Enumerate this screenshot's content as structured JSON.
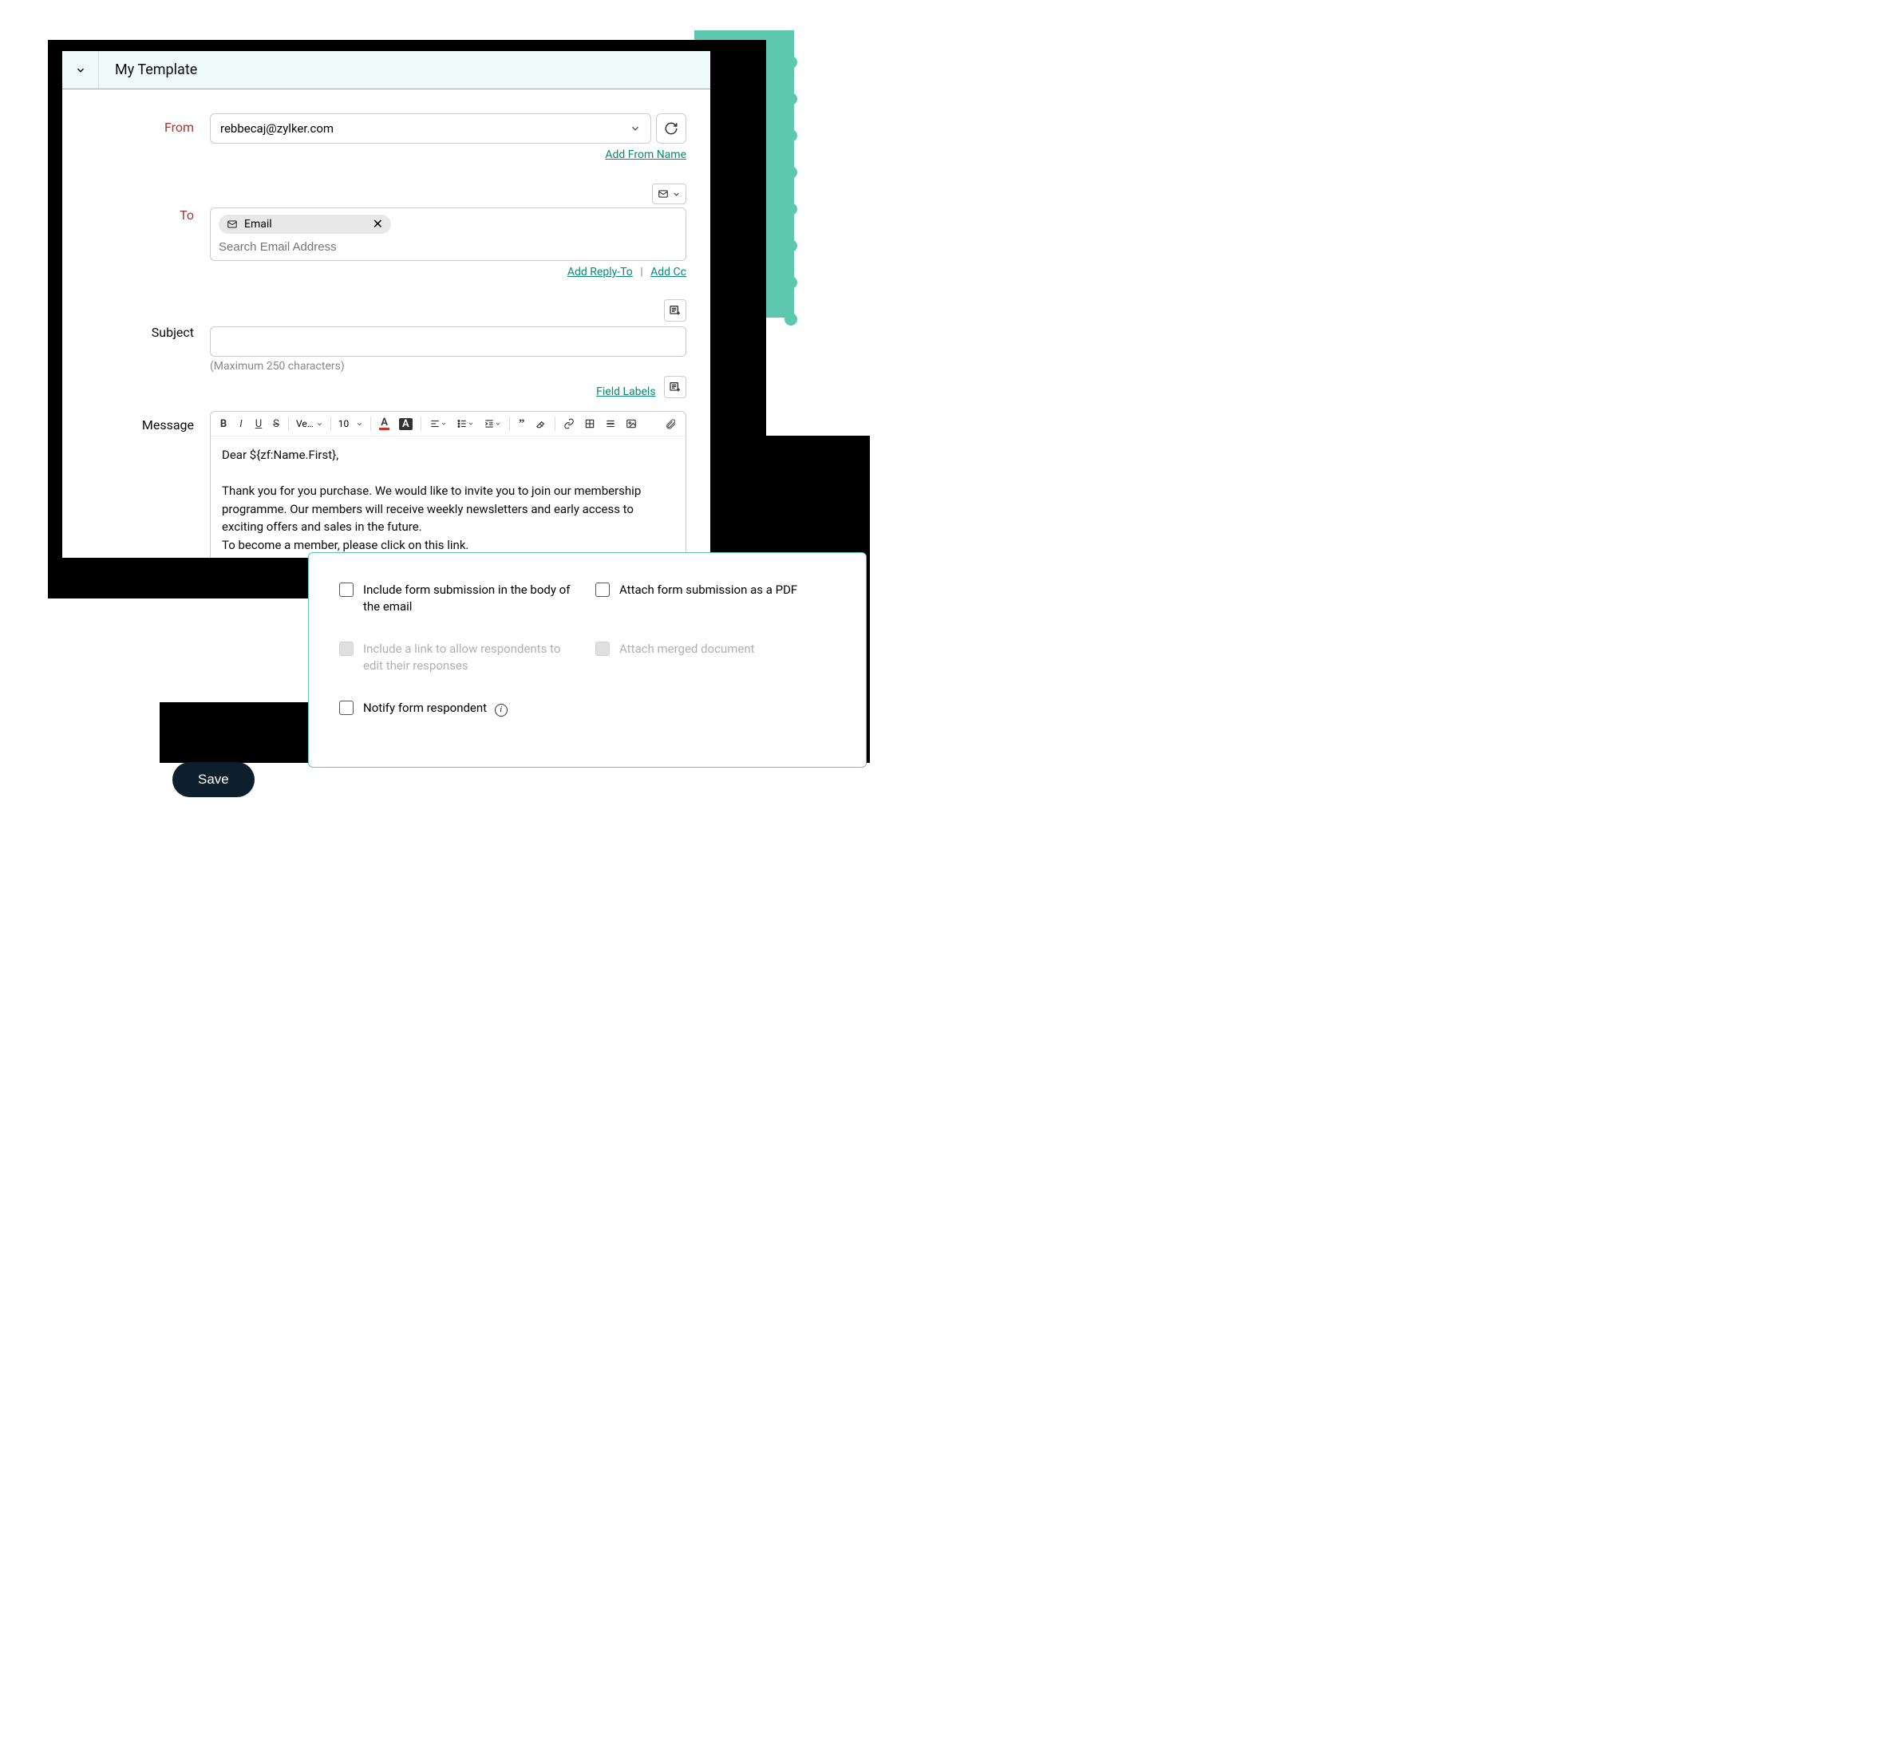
{
  "header": {
    "title": "My Template"
  },
  "from": {
    "label": "From",
    "value": "rebbecaj@zylker.com",
    "addFromNameLink": "Add From Name"
  },
  "to": {
    "label": "To",
    "chipLabel": "Email",
    "searchPlaceholder": "Search Email Address",
    "addReplyToLink": "Add Reply-To",
    "addCcLink": "Add Cc"
  },
  "subject": {
    "label": "Subject",
    "value": "",
    "hint": "(Maximum 250 characters)"
  },
  "message": {
    "label": "Message",
    "fieldLabelsLink": "Field Labels",
    "toolbar": {
      "font": "Ve…",
      "size": "10"
    },
    "body": "Dear ${zf:Name.First},\n\nThank you for you purchase. We would like to invite you to join our membership programme. Our members will receive weekly newsletters and early access to exciting offers and sales in the future.\nTo become a member, please click on this link."
  },
  "options": {
    "includeInBody": "Include form submission in the body of the email",
    "attachPdf": "Attach form submission as a PDF",
    "includeEditLink": "Include a link to allow respondents to edit their responses",
    "attachMerged": "Attach merged document",
    "notifyRespondent": "Notify form respondent"
  },
  "saveButton": "Save"
}
